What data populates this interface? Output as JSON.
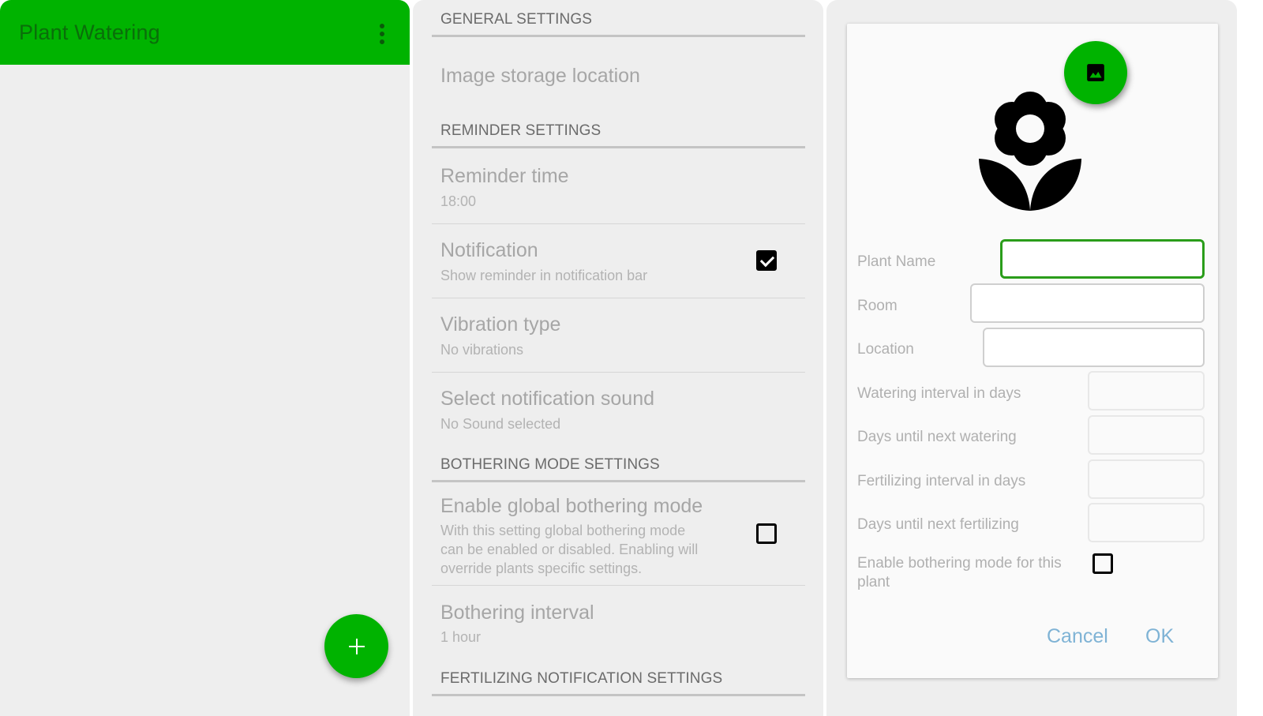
{
  "colors": {
    "primary": "#00b300",
    "primary_dark_text": "#0a6e0a",
    "dialog_button": "#7fb3d5",
    "focused_border": "#2a9d1a"
  },
  "main_screen": {
    "app_title": "Plant Watering",
    "overflow_icon": "more-vert-icon",
    "fab_icon": "plus-icon"
  },
  "settings_screen": {
    "sections": [
      {
        "header": "GENERAL SETTINGS",
        "items": [
          {
            "title": "Image storage location",
            "summary": ""
          }
        ]
      },
      {
        "header": "REMINDER SETTINGS",
        "items": [
          {
            "title": "Reminder time",
            "summary": "18:00"
          },
          {
            "title": "Notification",
            "summary": "Show reminder in notification bar",
            "checked": true
          },
          {
            "title": "Vibration type",
            "summary": "No vibrations"
          },
          {
            "title": "Select notification sound",
            "summary": "No Sound selected"
          }
        ]
      },
      {
        "header": "BOTHERING MODE SETTINGS",
        "items": [
          {
            "title": "Enable global bothering mode",
            "summary_lines": [
              "With this setting global bothering mode",
              "can be enabled or disabled. Enabling will",
              "override plants specific settings."
            ],
            "checked": false
          },
          {
            "title": "Bothering interval",
            "summary": "1 hour"
          }
        ]
      },
      {
        "header": "FERTILIZING NOTIFICATION SETTINGS",
        "items": []
      }
    ]
  },
  "add_plant_dialog": {
    "image_button_icon": "image-icon",
    "placeholder_icon": "flower-icon",
    "fields": [
      {
        "label": "Plant Name",
        "value": ""
      },
      {
        "label": "Room",
        "value": ""
      },
      {
        "label": "Location",
        "value": ""
      },
      {
        "label": "Watering interval in days",
        "value": ""
      },
      {
        "label": "Days until next watering",
        "value": ""
      },
      {
        "label": "Fertilizing interval in days",
        "value": ""
      },
      {
        "label": "Days until next fertilizing",
        "value": ""
      }
    ],
    "bothering_checkbox": {
      "label_lines": [
        "Enable bothering mode for this",
        "plant"
      ],
      "checked": false
    },
    "cancel_label": "Cancel",
    "ok_label": "OK"
  }
}
